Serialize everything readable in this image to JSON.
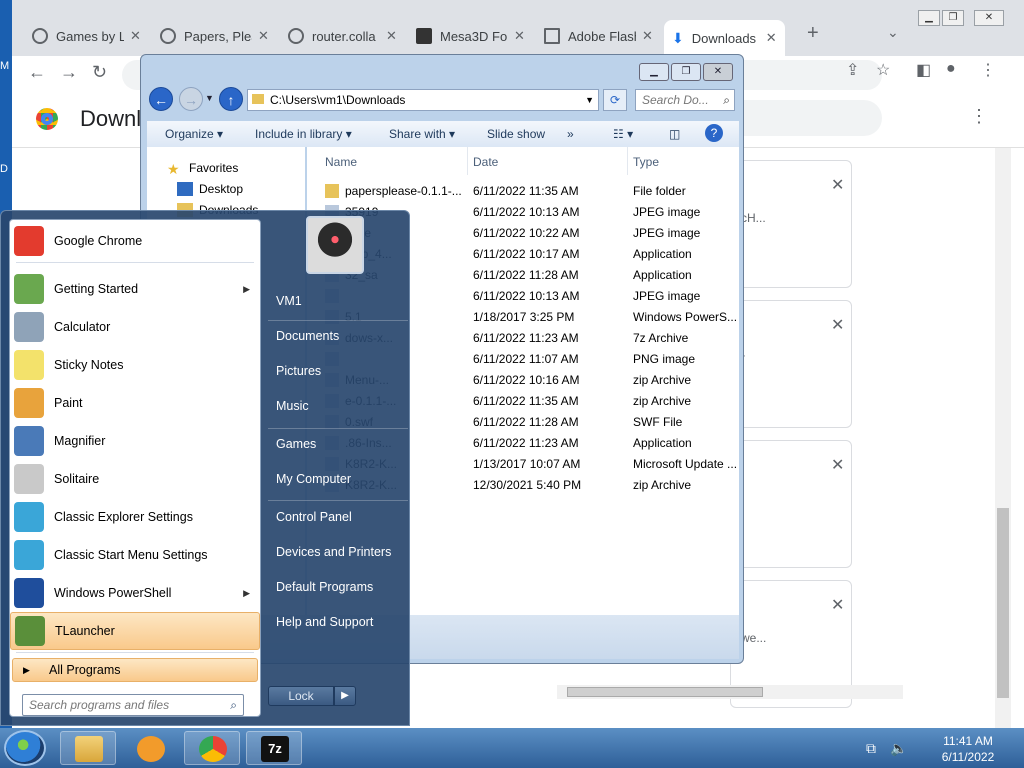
{
  "desktop": {
    "edge_labels": [
      "M",
      "D"
    ]
  },
  "chrome": {
    "tabs": [
      {
        "label": "Games by L",
        "icon": "globe-icon"
      },
      {
        "label": "Papers, Plea",
        "icon": "globe-icon"
      },
      {
        "label": "router.colla",
        "icon": "globe-icon"
      },
      {
        "label": "Mesa3D Fo",
        "icon": "fd-icon"
      },
      {
        "label": "Adobe Flash",
        "icon": "museum-icon"
      },
      {
        "label": "Downloads",
        "icon": "download-icon",
        "active": true
      }
    ],
    "new_tab": "+",
    "page_title": "Downl",
    "cards": [
      {
        "snippet": "cH..."
      },
      {
        "snippet": "r"
      },
      {
        "snippet": ""
      },
      {
        "snippet": "we..."
      }
    ]
  },
  "explorer": {
    "address": "C:\\Users\\vm1\\Downloads",
    "search_placeholder": "Search Do...",
    "commands": [
      "Organize",
      "Include in library",
      "Share with",
      "Slide show",
      "»"
    ],
    "nav": [
      {
        "label": "Favorites",
        "icon": "star-icon"
      },
      {
        "label": "Desktop",
        "icon": "desktop-icon"
      },
      {
        "label": "Downloads",
        "icon": "folder-icon"
      }
    ],
    "columns": {
      "name": "Name",
      "date": "Date",
      "type": "Type"
    },
    "files": [
      {
        "name": "papersplease-0.1.1-...",
        "date": "6/11/2022 11:35 AM",
        "type": "File folder"
      },
      {
        "name": "35919",
        "date": "6/11/2022 10:13 AM",
        "type": "JPEG image"
      },
      {
        "name": "rofile",
        "date": "6/11/2022 10:22 AM",
        "type": "JPEG image"
      },
      {
        "name": "etup_4...",
        "date": "6/11/2022 10:17 AM",
        "type": "Application"
      },
      {
        "name": "32_sa",
        "date": "6/11/2022 11:28 AM",
        "type": "Application"
      },
      {
        "name": "",
        "date": "6/11/2022 10:13 AM",
        "type": "JPEG image"
      },
      {
        "name": "5.1",
        "date": "1/18/2017 3:25 PM",
        "type": "Windows PowerS..."
      },
      {
        "name": "dows-x...",
        "date": "6/11/2022 11:23 AM",
        "type": "7z Archive"
      },
      {
        "name": "",
        "date": "6/11/2022 11:07 AM",
        "type": "PNG image"
      },
      {
        "name": "Menu-...",
        "date": "6/11/2022 10:16 AM",
        "type": "zip Archive"
      },
      {
        "name": "e-0.1.1-...",
        "date": "6/11/2022 11:35 AM",
        "type": "zip Archive"
      },
      {
        "name": "0.swf",
        "date": "6/11/2022 11:28 AM",
        "type": "SWF File"
      },
      {
        "name": ".86-Ins...",
        "date": "6/11/2022 11:23 AM",
        "type": "Application"
      },
      {
        "name": "K8R2-K...",
        "date": "1/13/2017 10:07 AM",
        "type": "Microsoft Update ..."
      },
      {
        "name": "K8R2-K...",
        "date": "12/30/2021 5:40 PM",
        "type": "zip Archive"
      }
    ]
  },
  "startmenu": {
    "programs": [
      {
        "label": "Google Chrome",
        "icon": "chrome-icon",
        "color": "#e33b2e"
      },
      {
        "label": "Getting Started",
        "icon": "getting-started-icon",
        "color": "#6aa84f",
        "submenu": true
      },
      {
        "label": "Calculator",
        "icon": "calculator-icon",
        "color": "#8fa3b8"
      },
      {
        "label": "Sticky Notes",
        "icon": "sticky-notes-icon",
        "color": "#f3e26b"
      },
      {
        "label": "Paint",
        "icon": "paint-icon",
        "color": "#e8a33c"
      },
      {
        "label": "Magnifier",
        "icon": "magnifier-icon",
        "color": "#4a7ab8"
      },
      {
        "label": "Solitaire",
        "icon": "solitaire-icon",
        "color": "#c9c9c9"
      },
      {
        "label": "Classic Explorer Settings",
        "icon": "shell-icon",
        "color": "#3aa6d8"
      },
      {
        "label": "Classic Start Menu Settings",
        "icon": "shell-icon",
        "color": "#3aa6d8"
      },
      {
        "label": "Windows PowerShell",
        "icon": "powershell-icon",
        "color": "#1f4e9c",
        "submenu": true
      },
      {
        "label": "TLauncher",
        "icon": "tlauncher-icon",
        "color": "#5a8f3a",
        "highlight": true
      }
    ],
    "all_programs": "All Programs",
    "search_placeholder": "Search programs and files",
    "right": [
      "VM1",
      "Documents",
      "Pictures",
      "Music",
      "Games",
      "My Computer",
      "Control Panel",
      "Devices and Printers",
      "Default Programs",
      "Help and Support"
    ],
    "lock": "Lock"
  },
  "taskbar": {
    "time": "11:41 AM",
    "date": "6/11/2022",
    "buttons": [
      "explorer",
      "media-player",
      "chrome",
      "7zip"
    ]
  }
}
